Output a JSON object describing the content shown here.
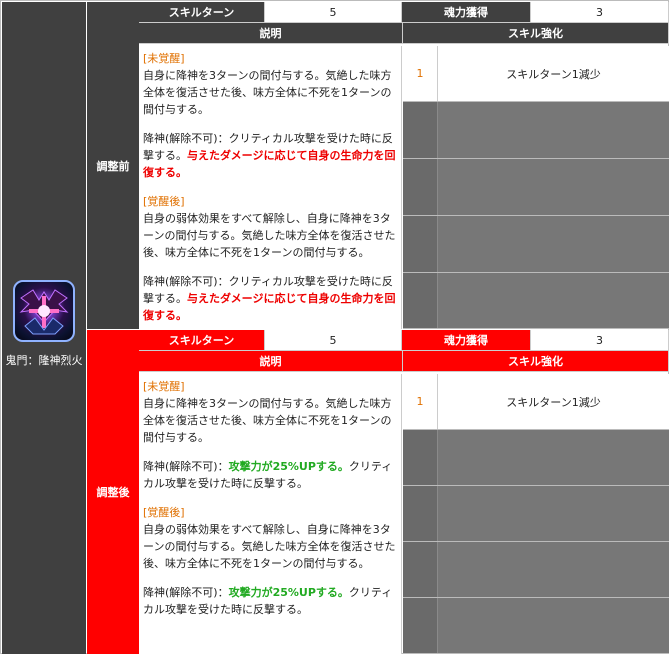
{
  "character": {
    "name": "鬼門：隆神烈火",
    "icon": "demon-gate-skill-icon"
  },
  "sections": {
    "before": {
      "label": "調整前",
      "skill_turn_label": "スキルターン",
      "skill_turn_value": "5",
      "soul_gain_label": "魂力獲得",
      "soul_gain_value": "3",
      "desc_header": "説明",
      "enh_header": "スキル強化",
      "desc": {
        "tag1": "[未覚醒]",
        "p1": "自身に降神を3ターンの間付与する。気絶した味方全体を復活させた後、味方全体に不死を1ターンの間付与する。",
        "p2_a": "降神(解除不可)：クリティカル攻撃を受けた時に反撃する。",
        "p2_b": "与えたダメージに応じて自身の生命力を回復する。",
        "tag2": "[覚醒後]",
        "p3": "自身の弱体効果をすべて解除し、自身に降神を3ターンの間付与する。気絶した味方全体を復活させた後、味方全体に不死を1ターンの間付与する。",
        "p4_a": "降神(解除不可)：クリティカル攻撃を受けた時に反撃する。",
        "p4_b": "与えたダメージに応じて自身の生命力を回復する。"
      },
      "enhancements": [
        {
          "num": "1",
          "text": "スキルターン1減少"
        }
      ]
    },
    "after": {
      "label": "調整後",
      "skill_turn_label": "スキルターン",
      "skill_turn_value": "5",
      "soul_gain_label": "魂力獲得",
      "soul_gain_value": "3",
      "desc_header": "説明",
      "enh_header": "スキル強化",
      "desc": {
        "tag1": "[未覚醒]",
        "p1": "自身に降神を3ターンの間付与する。気絶した味方全体を復活させた後、味方全体に不死を1ターンの間付与する。",
        "p2_a": "降神(解除不可)：",
        "p2_b": "攻撃力が25%UPする。",
        "p2_c": "クリティカル攻撃を受けた時に反撃する。",
        "tag2": "[覚醒後]",
        "p3": "自身の弱体効果をすべて解除し、自身に降神を3ターンの間付与する。気絶した味方全体を復活させた後、味方全体に不死を1ターンの間付与する。",
        "p4_a": "降神(解除不可)：",
        "p4_b": "攻撃力が25%UPする。",
        "p4_c": "クリティカル攻撃を受けた時に反撃する。"
      },
      "enhancements": [
        {
          "num": "1",
          "text": "スキルターン1減少"
        }
      ]
    }
  },
  "colors": {
    "dark_header": "#404040",
    "red_header": "#ff0000",
    "awaken_tag": "#e07000",
    "emphasis_red": "#ee0000",
    "emphasis_green": "#22aa22",
    "empty_cell": "#777777"
  }
}
